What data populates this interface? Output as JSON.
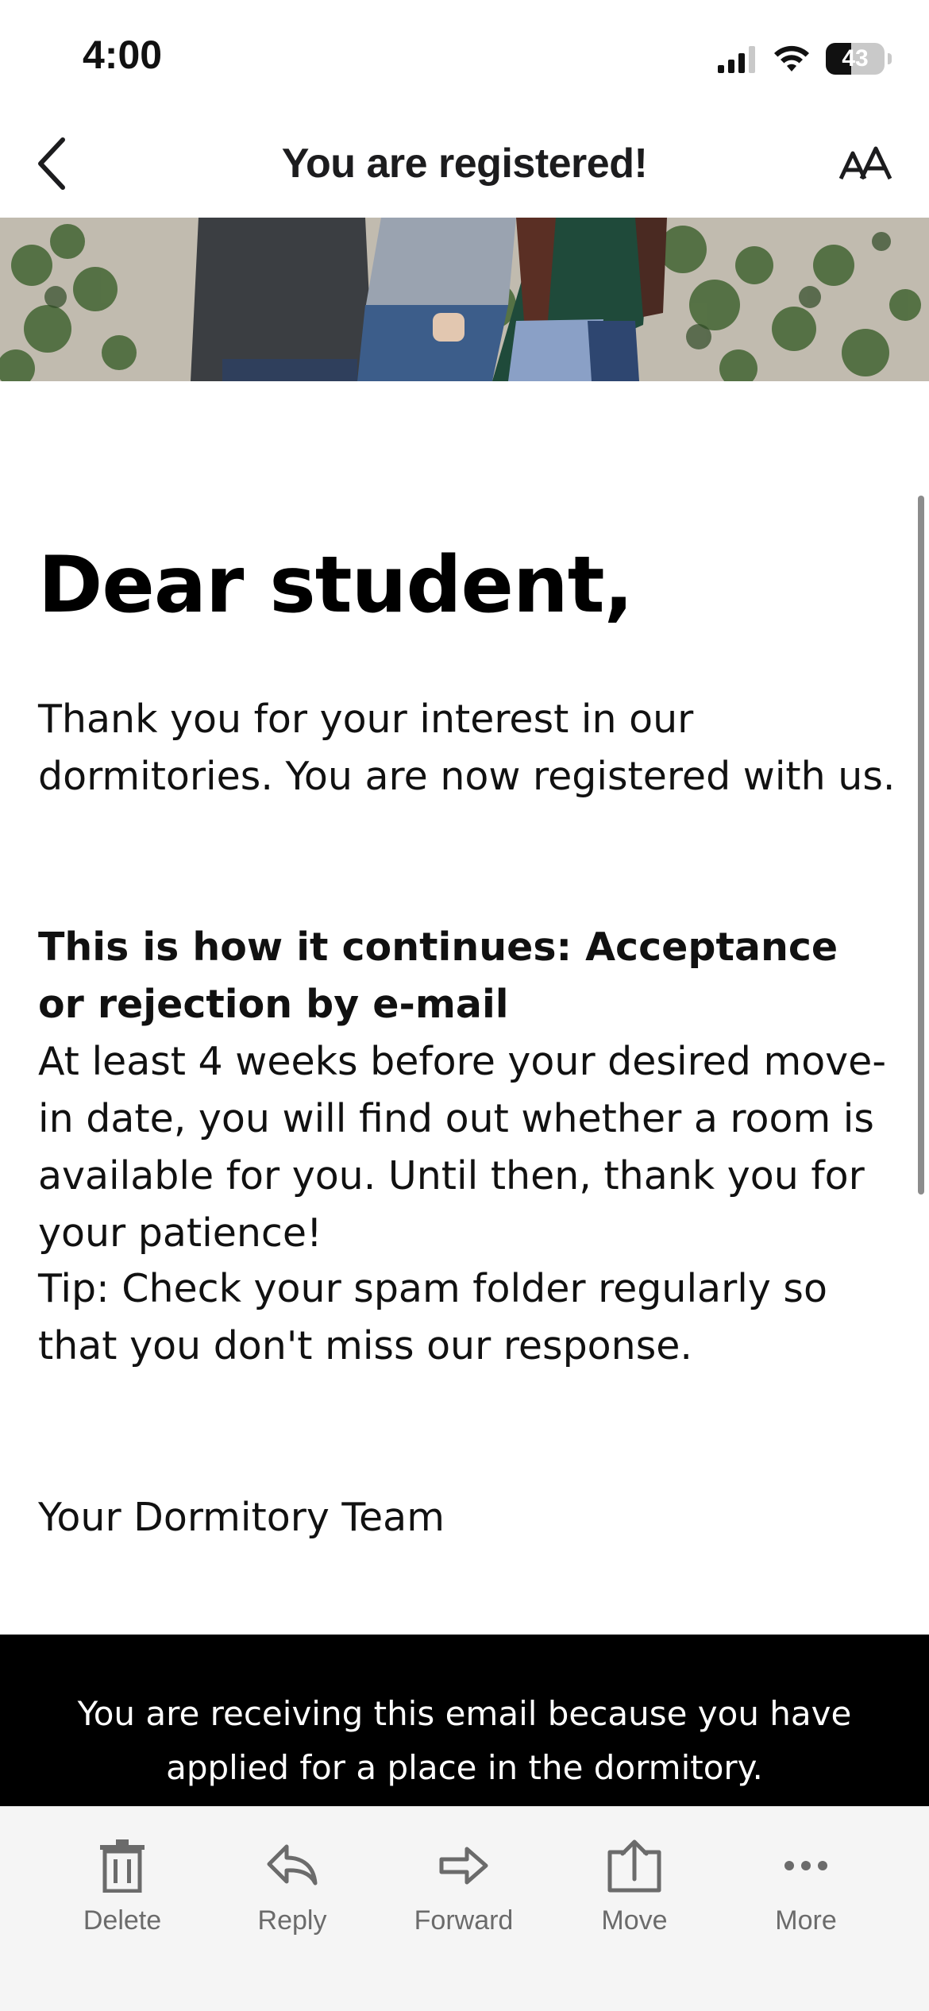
{
  "status_bar": {
    "time": "4:00",
    "battery": "43",
    "battery_level": 0.43
  },
  "nav": {
    "title": "You are registered!",
    "back_icon": "chevron-left-icon",
    "text_size_icon": "text-size-icon"
  },
  "email": {
    "greeting": "Dear student,",
    "paragraph1": "Thank you for your interest in our dormitories. You are now registered with us.",
    "next_steps_heading": "This is how it continues: Acceptance or rejection by e-mail",
    "next_steps_body": "At least 4 weeks before your desired move-in date, you will find out whether a room is available for you. Until then, thank you for your patience!",
    "tip": "Tip: Check your spam folder regularly so that you don't miss our response.",
    "signature": "Your Dormitory Team",
    "footer_note": "You are receiving this email because you have applied for a place in the dormitory."
  },
  "toolbar": {
    "items": [
      {
        "label": "Delete",
        "icon": "trash-icon"
      },
      {
        "label": "Reply",
        "icon": "reply-icon"
      },
      {
        "label": "Forward",
        "icon": "forward-icon"
      },
      {
        "label": "Move",
        "icon": "move-icon"
      },
      {
        "label": "More",
        "icon": "more-icon"
      }
    ]
  },
  "colors": {
    "footer_background": "#000000",
    "toolbar_background": "#f5f5f5",
    "toolbar_icon": "#6b6b6b"
  }
}
